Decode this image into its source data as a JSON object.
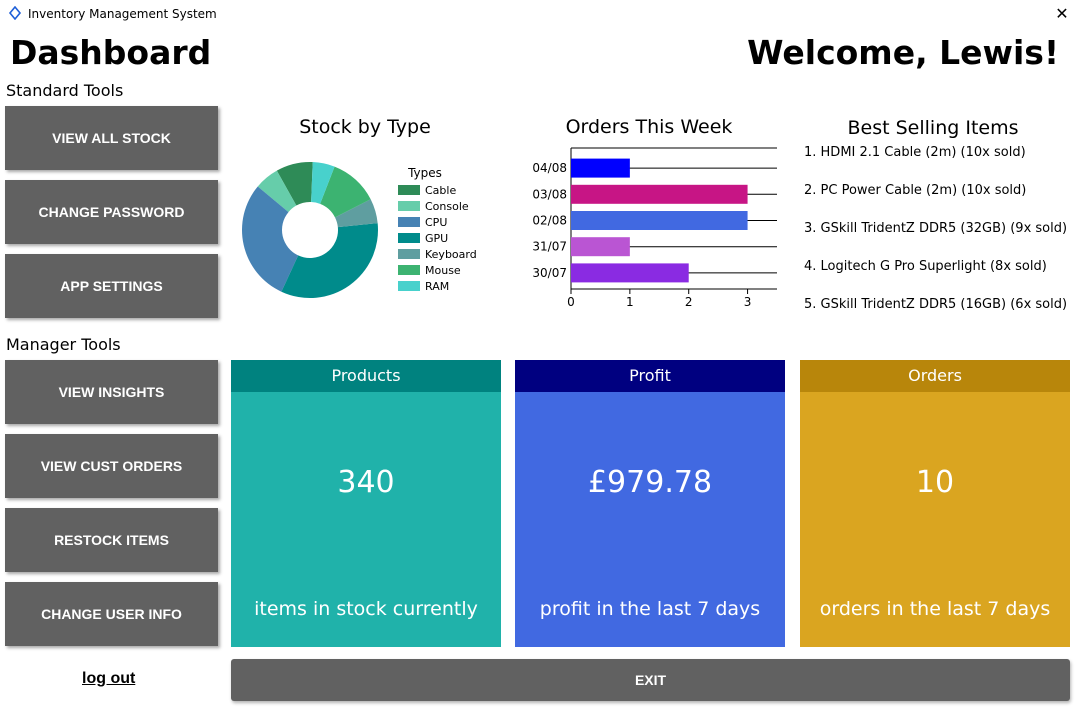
{
  "window": {
    "title": "Inventory Management System",
    "icon": "diamond-outline-icon",
    "close_label": "✕"
  },
  "header": {
    "title": "Dashboard",
    "welcome": "Welcome, Lewis!"
  },
  "standard_tools": {
    "label": "Standard Tools",
    "buttons": [
      "VIEW ALL STOCK",
      "CHANGE PASSWORD",
      "APP SETTINGS"
    ]
  },
  "manager_tools": {
    "label": "Manager Tools",
    "buttons": [
      "VIEW INSIGHTS",
      "VIEW CUST ORDERS",
      "RESTOCK ITEMS",
      "CHANGE USER INFO"
    ]
  },
  "logout_label": "log out",
  "exit_label": "EXIT",
  "colors": {
    "button_bg": "#616161",
    "products_head": "#00827f",
    "products_body": "#20b2aa",
    "profit_head": "#000080",
    "profit_body": "#4169e1",
    "orders_head": "#b8860b",
    "orders_body": "#daa520"
  },
  "chart_data": [
    {
      "type": "pie",
      "title": "Stock by Type",
      "legend_title": "Types",
      "legend_position": "right",
      "labels": [
        "Cable",
        "Console",
        "CPU",
        "GPU",
        "Keyboard",
        "Mouse",
        "RAM"
      ],
      "colors": [
        "#2e8b57",
        "#66cdaa",
        "#4682b4",
        "#008b8b",
        "#5f9ea0",
        "#3cb371",
        "#48d1cc"
      ],
      "slices": [
        {
          "label": "Cable",
          "value": 30
        },
        {
          "label": "Console",
          "value": 20
        },
        {
          "label": "CPU",
          "value": 100
        },
        {
          "label": "GPU",
          "value": 115
        },
        {
          "label": "Keyboard",
          "value": 20
        },
        {
          "label": "Mouse",
          "value": 40
        },
        {
          "label": "RAM",
          "value": 18
        }
      ],
      "donut": true
    },
    {
      "type": "bar",
      "orientation": "horizontal",
      "title": "Orders This Week",
      "categories": [
        "04/08",
        "03/08",
        "02/08",
        "31/07",
        "30/07"
      ],
      "values": [
        1,
        3,
        3,
        1,
        2
      ],
      "colors": [
        "#0000ff",
        "#c71585",
        "#4169e1",
        "#ba55d3",
        "#8a2be2"
      ],
      "xlim": [
        0,
        3.5
      ],
      "xticks": [
        0,
        1,
        2,
        3
      ],
      "grid": true
    }
  ],
  "best_selling": {
    "title": "Best Selling Items",
    "items": [
      "1. HDMI 2.1 Cable (2m) (10x sold)",
      "2. PC Power Cable (2m) (10x sold)",
      "3. GSkill TridentZ DDR5 (32GB) (9x sold)",
      "4. Logitech G Pro Superlight (8x sold)",
      "5. GSkill TridentZ DDR5 (16GB) (6x sold)"
    ]
  },
  "cards": {
    "products": {
      "title": "Products",
      "value": "340",
      "caption": "items in stock currently"
    },
    "profit": {
      "title": "Profit",
      "value": "£979.78",
      "caption": "profit in the last 7 days"
    },
    "orders": {
      "title": "Orders",
      "value": "10",
      "caption": "orders in the last 7 days"
    }
  }
}
